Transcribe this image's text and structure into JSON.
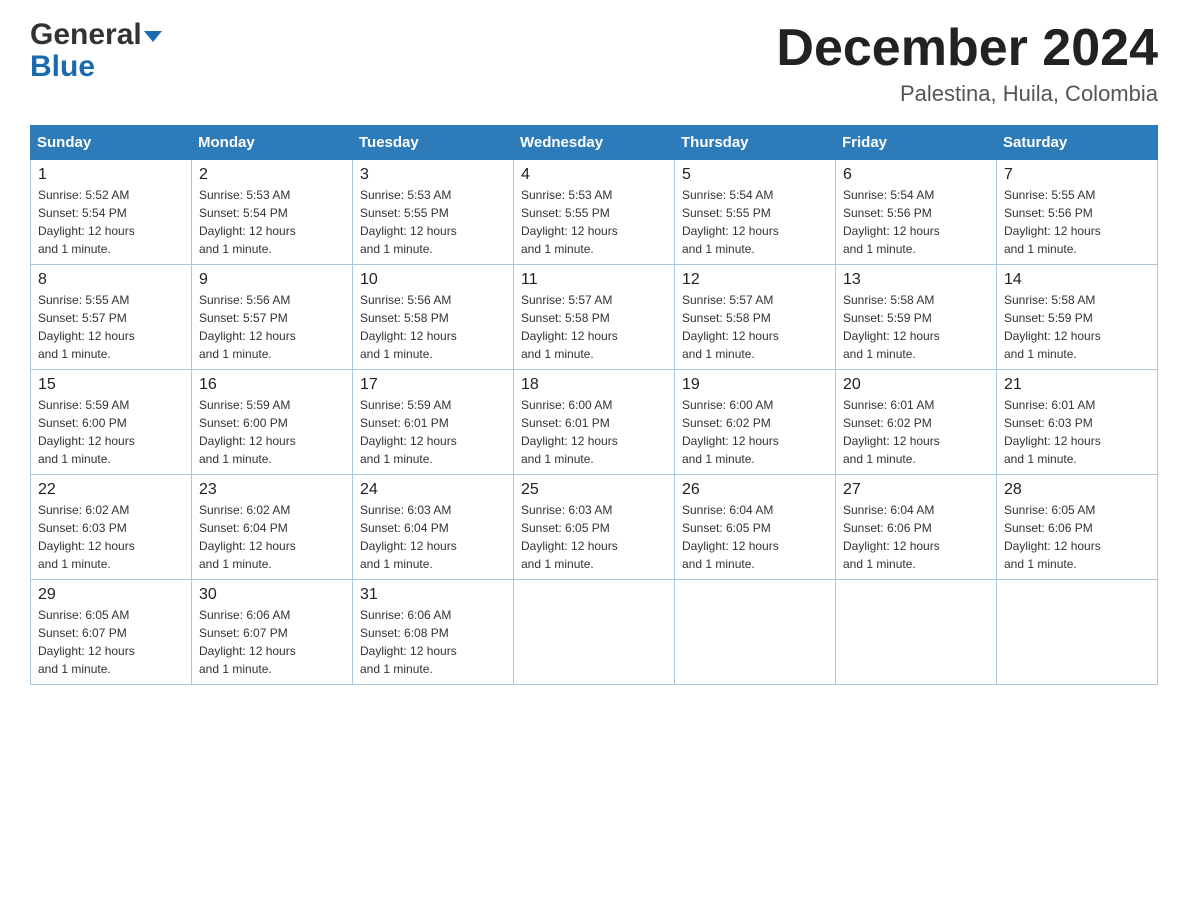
{
  "header": {
    "logo_general": "General",
    "logo_blue": "Blue",
    "title": "December 2024",
    "subtitle": "Palestina, Huila, Colombia"
  },
  "weekdays": [
    "Sunday",
    "Monday",
    "Tuesday",
    "Wednesday",
    "Thursday",
    "Friday",
    "Saturday"
  ],
  "weeks": [
    [
      {
        "day": "1",
        "sunrise": "5:52 AM",
        "sunset": "5:54 PM",
        "daylight": "12 hours and 1 minute."
      },
      {
        "day": "2",
        "sunrise": "5:53 AM",
        "sunset": "5:54 PM",
        "daylight": "12 hours and 1 minute."
      },
      {
        "day": "3",
        "sunrise": "5:53 AM",
        "sunset": "5:55 PM",
        "daylight": "12 hours and 1 minute."
      },
      {
        "day": "4",
        "sunrise": "5:53 AM",
        "sunset": "5:55 PM",
        "daylight": "12 hours and 1 minute."
      },
      {
        "day": "5",
        "sunrise": "5:54 AM",
        "sunset": "5:55 PM",
        "daylight": "12 hours and 1 minute."
      },
      {
        "day": "6",
        "sunrise": "5:54 AM",
        "sunset": "5:56 PM",
        "daylight": "12 hours and 1 minute."
      },
      {
        "day": "7",
        "sunrise": "5:55 AM",
        "sunset": "5:56 PM",
        "daylight": "12 hours and 1 minute."
      }
    ],
    [
      {
        "day": "8",
        "sunrise": "5:55 AM",
        "sunset": "5:57 PM",
        "daylight": "12 hours and 1 minute."
      },
      {
        "day": "9",
        "sunrise": "5:56 AM",
        "sunset": "5:57 PM",
        "daylight": "12 hours and 1 minute."
      },
      {
        "day": "10",
        "sunrise": "5:56 AM",
        "sunset": "5:58 PM",
        "daylight": "12 hours and 1 minute."
      },
      {
        "day": "11",
        "sunrise": "5:57 AM",
        "sunset": "5:58 PM",
        "daylight": "12 hours and 1 minute."
      },
      {
        "day": "12",
        "sunrise": "5:57 AM",
        "sunset": "5:58 PM",
        "daylight": "12 hours and 1 minute."
      },
      {
        "day": "13",
        "sunrise": "5:58 AM",
        "sunset": "5:59 PM",
        "daylight": "12 hours and 1 minute."
      },
      {
        "day": "14",
        "sunrise": "5:58 AM",
        "sunset": "5:59 PM",
        "daylight": "12 hours and 1 minute."
      }
    ],
    [
      {
        "day": "15",
        "sunrise": "5:59 AM",
        "sunset": "6:00 PM",
        "daylight": "12 hours and 1 minute."
      },
      {
        "day": "16",
        "sunrise": "5:59 AM",
        "sunset": "6:00 PM",
        "daylight": "12 hours and 1 minute."
      },
      {
        "day": "17",
        "sunrise": "5:59 AM",
        "sunset": "6:01 PM",
        "daylight": "12 hours and 1 minute."
      },
      {
        "day": "18",
        "sunrise": "6:00 AM",
        "sunset": "6:01 PM",
        "daylight": "12 hours and 1 minute."
      },
      {
        "day": "19",
        "sunrise": "6:00 AM",
        "sunset": "6:02 PM",
        "daylight": "12 hours and 1 minute."
      },
      {
        "day": "20",
        "sunrise": "6:01 AM",
        "sunset": "6:02 PM",
        "daylight": "12 hours and 1 minute."
      },
      {
        "day": "21",
        "sunrise": "6:01 AM",
        "sunset": "6:03 PM",
        "daylight": "12 hours and 1 minute."
      }
    ],
    [
      {
        "day": "22",
        "sunrise": "6:02 AM",
        "sunset": "6:03 PM",
        "daylight": "12 hours and 1 minute."
      },
      {
        "day": "23",
        "sunrise": "6:02 AM",
        "sunset": "6:04 PM",
        "daylight": "12 hours and 1 minute."
      },
      {
        "day": "24",
        "sunrise": "6:03 AM",
        "sunset": "6:04 PM",
        "daylight": "12 hours and 1 minute."
      },
      {
        "day": "25",
        "sunrise": "6:03 AM",
        "sunset": "6:05 PM",
        "daylight": "12 hours and 1 minute."
      },
      {
        "day": "26",
        "sunrise": "6:04 AM",
        "sunset": "6:05 PM",
        "daylight": "12 hours and 1 minute."
      },
      {
        "day": "27",
        "sunrise": "6:04 AM",
        "sunset": "6:06 PM",
        "daylight": "12 hours and 1 minute."
      },
      {
        "day": "28",
        "sunrise": "6:05 AM",
        "sunset": "6:06 PM",
        "daylight": "12 hours and 1 minute."
      }
    ],
    [
      {
        "day": "29",
        "sunrise": "6:05 AM",
        "sunset": "6:07 PM",
        "daylight": "12 hours and 1 minute."
      },
      {
        "day": "30",
        "sunrise": "6:06 AM",
        "sunset": "6:07 PM",
        "daylight": "12 hours and 1 minute."
      },
      {
        "day": "31",
        "sunrise": "6:06 AM",
        "sunset": "6:08 PM",
        "daylight": "12 hours and 1 minute."
      },
      null,
      null,
      null,
      null
    ]
  ],
  "labels": {
    "sunrise": "Sunrise:",
    "sunset": "Sunset:",
    "daylight": "Daylight:"
  }
}
